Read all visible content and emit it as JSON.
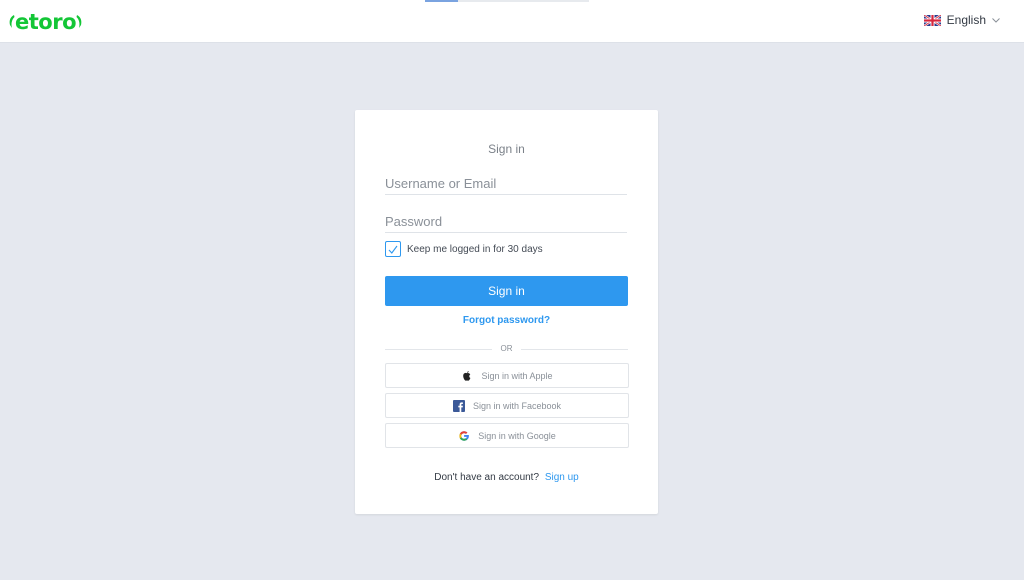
{
  "header": {
    "logo_text": "etoro",
    "progress_fraction": 0.2,
    "language": {
      "label": "English",
      "flag_icon": "uk-flag-icon",
      "chevron_icon": "chevron-down-icon"
    }
  },
  "form": {
    "title": "Sign in",
    "username": {
      "placeholder": "Username or Email",
      "value": ""
    },
    "password": {
      "placeholder": "Password",
      "value": ""
    },
    "remember": {
      "label": "Keep me logged in for 30 days",
      "checked": true
    },
    "submit_label": "Sign in",
    "forgot_label": "Forgot password?",
    "divider_label": "OR",
    "social": [
      {
        "label": "Sign in with Apple",
        "icon": "apple-icon"
      },
      {
        "label": "Sign in with Facebook",
        "icon": "facebook-icon"
      },
      {
        "label": "Sign in with Google",
        "icon": "google-icon"
      }
    ],
    "signup_prompt": "Don't have an account?",
    "signup_link": "Sign up"
  },
  "colors": {
    "brand_green": "#13c636",
    "primary_blue": "#2e98ef",
    "background": "#e5e8ef"
  }
}
